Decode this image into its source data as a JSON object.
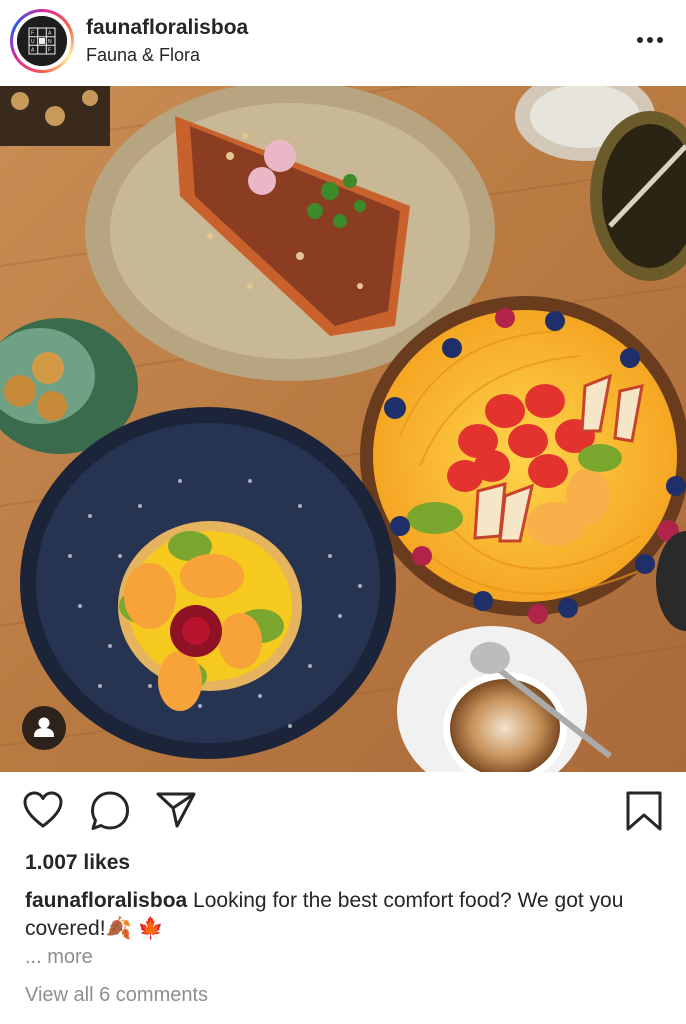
{
  "post": {
    "username": "faunafloralisboa",
    "location": "Fauna & Flora",
    "likes": "1.007 likes",
    "caption_user": "faunafloralisboa",
    "caption_text": "Looking for the best comfort food? We got you covered!",
    "caption_emoji": "🍂 🍁",
    "more_label": "... more",
    "comments_label": "View all 6 comments"
  },
  "icons": {
    "more": "more-options-icon",
    "like": "heart-icon",
    "comment": "comment-icon",
    "share": "paper-plane-icon",
    "save": "bookmark-icon",
    "tag": "user-tag-icon"
  }
}
